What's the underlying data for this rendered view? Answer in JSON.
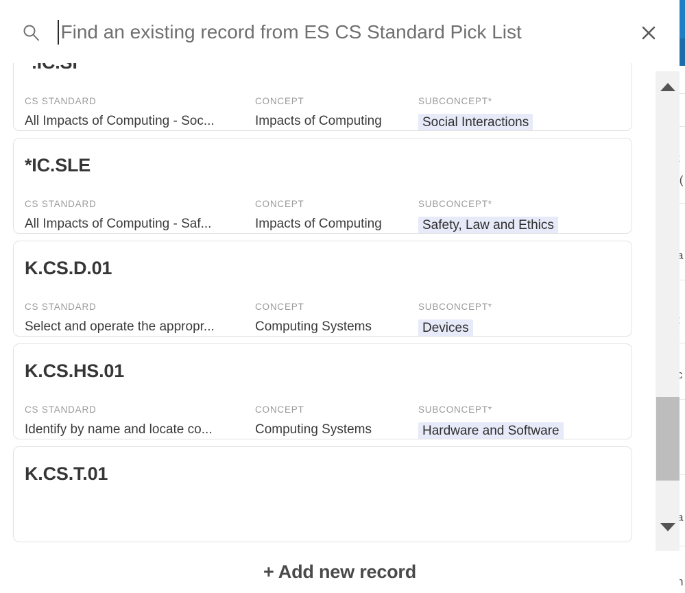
{
  "search": {
    "placeholder": "Find an existing record from ES CS Standard Pick List",
    "value": "",
    "icon": "search-icon",
    "close_icon": "close-icon"
  },
  "field_labels": {
    "cs_standard": "CS STANDARD",
    "concept": "CONCEPT",
    "subconcept": "SUBCONCEPT*"
  },
  "records": [
    {
      "title": "*.IC.SI",
      "cs_standard": "All Impacts of Computing - Soc...",
      "concept": "Impacts of Computing",
      "subconcept": "Social Interactions"
    },
    {
      "title": "*IC.SLE",
      "cs_standard": "All Impacts of Computing - Saf...",
      "concept": "Impacts of Computing",
      "subconcept": "Safety, Law and Ethics"
    },
    {
      "title": "K.CS.D.01",
      "cs_standard": "Select and operate the appropr...",
      "concept": "Computing Systems",
      "subconcept": "Devices"
    },
    {
      "title": "K.CS.HS.01",
      "cs_standard": "Identify by name and locate co...",
      "concept": "Computing Systems",
      "subconcept": "Hardware and Software"
    },
    {
      "title": "K.CS.T.01",
      "cs_standard": "",
      "concept": "",
      "subconcept": ""
    }
  ],
  "footer": {
    "add_new_record_label": "+ Add new record"
  },
  "scrollbar": {
    "up_arrow_icon": "triangle-up-icon",
    "down_arrow_icon": "triangle-down-icon"
  },
  "background": {
    "accent_color": "#1f7ec4",
    "fragments": [
      "t",
      "l(",
      "a",
      "t",
      "c",
      "l",
      "|",
      "a",
      "h"
    ]
  },
  "colors": {
    "chip_background": "#e7eaf8",
    "card_border": "#e2e2e2",
    "label_text": "#9a9a9a",
    "value_text": "#3b3b3b",
    "title_text": "#363636",
    "scrollbar_thumb": "#bdbdbd",
    "scrollbar_track": "#f1f1f1"
  }
}
